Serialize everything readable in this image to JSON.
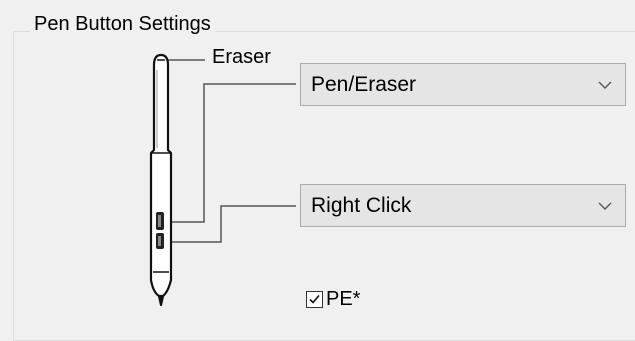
{
  "group": {
    "title": "Pen Button Settings"
  },
  "pen": {
    "eraser_label": "Eraser"
  },
  "eraser_dropdown": {
    "value": "Pen/Eraser"
  },
  "lower_button_dropdown": {
    "value": "Right Click"
  },
  "pe_checkbox": {
    "label": "PE*",
    "checked": true
  },
  "icons": {
    "dropdown_arrow": "chevron-down-icon",
    "checkmark": "checkmark-icon",
    "pen": "pen-illustration"
  }
}
